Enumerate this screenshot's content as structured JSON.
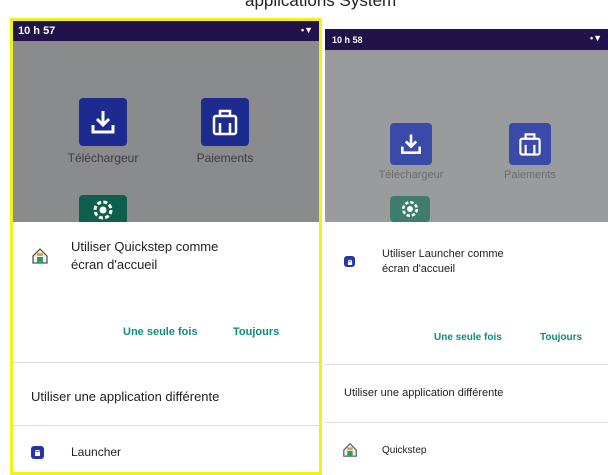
{
  "caption": "applications System",
  "left": {
    "status_time": "10 h 57",
    "status_icons": "•▼",
    "apps": [
      {
        "label": "Téléchargeur"
      },
      {
        "label": "Paiements"
      }
    ],
    "sheet": {
      "title_line1": "Utiliser Quickstep comme",
      "title_line2": "écran d'accueil",
      "once": "Une seule fois",
      "always": "Toujours",
      "other_title": "Utiliser une application différente",
      "alt_app": "Launcher"
    }
  },
  "right": {
    "status_time": "10 h 58",
    "status_icons": "•▼",
    "apps": [
      {
        "label": "Téléchargeur"
      },
      {
        "label": "Paiements"
      }
    ],
    "sheet": {
      "title_line1": "Utiliser Launcher comme",
      "title_line2": "écran d'accueil",
      "once": "Une seule fois",
      "always": "Toujours",
      "other_title": "Utiliser une application différente",
      "alt_app": "Quickstep"
    }
  },
  "colors": {
    "status_bar": "#21134a",
    "accent": "#0f8c7d",
    "highlight_border": "#f2f21a",
    "launcher_icon": "#2534a8"
  }
}
